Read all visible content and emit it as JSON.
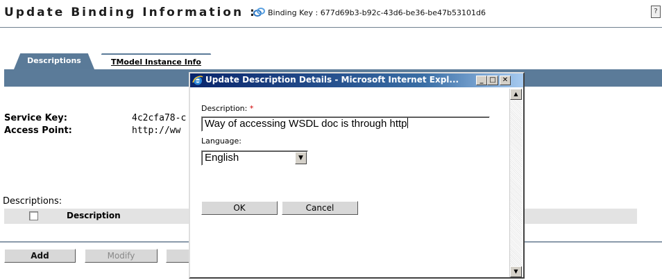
{
  "header": {
    "title": "Update Binding Information",
    "separator": ":",
    "binding_key": "Binding Key : 677d69b3-b92c-43d6-be36-be47b53101d6"
  },
  "tabs": [
    {
      "label": "Descriptions",
      "active": true
    },
    {
      "label": "TModel Instance Info",
      "active": false
    }
  ],
  "details": {
    "service_key_label": "Service Key:",
    "service_key_value": "4c2cfa78-c",
    "access_point_label": "Access Point:",
    "access_point_value": "http://ww"
  },
  "descriptions_section": {
    "label": "Descriptions:",
    "column_header": "Description"
  },
  "actions": {
    "add": "Add",
    "modify": "Modify"
  },
  "popup": {
    "title": "Update Description Details - Microsoft Internet Expl...",
    "description_label": "Description:",
    "required_marker": "*",
    "description_value": "Way of accessing WSDL doc is through http",
    "language_label": "Language:",
    "language_value": "English",
    "ok": "OK",
    "cancel": "Cancel"
  },
  "colors": {
    "tab_bar": "#5b7b99",
    "title_bar_start": "#08246b",
    "required": "#d00000"
  },
  "icons": [
    "binding-icon",
    "help-icon",
    "ie-icon",
    "minimize-icon",
    "maximize-icon",
    "close-icon",
    "scroll-up-icon",
    "scroll-down-icon",
    "dropdown-arrow-icon"
  ]
}
